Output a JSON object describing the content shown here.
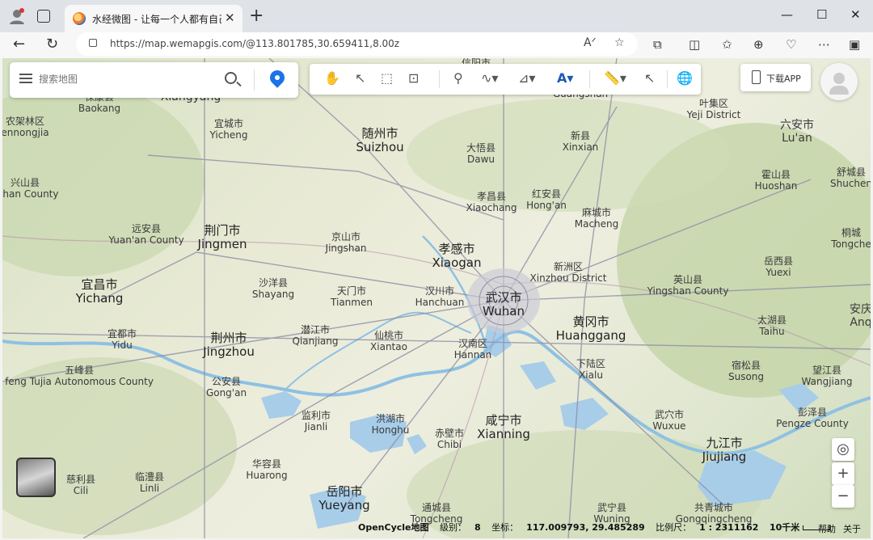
{
  "browser": {
    "tab_title": "水经微图 - 让每一个人都有自己的",
    "url": "https://map.wemapgis.com/@113.801785,30.659411,8.00z",
    "new_tab": "+",
    "close": "✕",
    "minimize": "—",
    "maximize": "☐",
    "window_close": "✕"
  },
  "search": {
    "placeholder": "搜索地图"
  },
  "toolbar_icons": [
    "hand-pan-icon",
    "select-arrow-icon",
    "box-select-icon",
    "zoom-box-icon",
    "marker-icon",
    "polyline-icon",
    "polygon-icon",
    "text-icon",
    "measure-icon",
    "pick-icon",
    "globe-icon"
  ],
  "download_app": "下载APP",
  "controls": {
    "locate": "◎",
    "zoom_in": "+",
    "zoom_out": "−"
  },
  "status": {
    "source": "OpenCycle地图",
    "level_label": "级别：",
    "level": "8",
    "coord_label": "坐标：",
    "coord": "117.009793, 29.485289",
    "scale_label": "比例尺：",
    "scale": "1 : 2311162",
    "scalebar": "10千米",
    "help": "帮助",
    "about": "关于"
  },
  "cities": [
    {
      "cn": "保康县",
      "en": "Baokang",
      "size": "small"
    },
    {
      "cn": "",
      "en": "Xiangyang",
      "size": "big"
    },
    {
      "cn": "宜城市",
      "en": "Yicheng",
      "size": "small"
    },
    {
      "cn": "随州市",
      "en": "Suizhou",
      "size": "major"
    },
    {
      "cn": "大悟县",
      "en": "Dawu",
      "size": "small"
    },
    {
      "cn": "",
      "en": "Guangshan",
      "size": "small"
    },
    {
      "cn": "新县",
      "en": "Xinxian",
      "size": "small"
    },
    {
      "cn": "叶集区",
      "en": "Yeji District",
      "size": "small"
    },
    {
      "cn": "六安市",
      "en": "Lu'an",
      "size": "big"
    },
    {
      "cn": "农架林区",
      "en": "ennongjia",
      "size": "small"
    },
    {
      "cn": "兴山县",
      "en": "gshan County",
      "size": "small"
    },
    {
      "cn": "孝昌县",
      "en": "Xiaochang",
      "size": "small"
    },
    {
      "cn": "红安县",
      "en": "Hong'an",
      "size": "small"
    },
    {
      "cn": "麻城市",
      "en": "Macheng",
      "size": "small"
    },
    {
      "cn": "霍山县",
      "en": "Huoshan",
      "size": "small"
    },
    {
      "cn": "舒城县",
      "en": "Shuchen",
      "size": "small"
    },
    {
      "cn": "远安县",
      "en": "Yuan'an County",
      "size": "small"
    },
    {
      "cn": "荆门市",
      "en": "Jingmen",
      "size": "major"
    },
    {
      "cn": "京山市",
      "en": "Jingshan",
      "size": "small"
    },
    {
      "cn": "孝感市",
      "en": "Xiaogan",
      "size": "major"
    },
    {
      "cn": "新洲区",
      "en": "Xinzhou District",
      "size": "small"
    },
    {
      "cn": "桐城",
      "en": "Tongche",
      "size": "small"
    },
    {
      "cn": "岳西县",
      "en": "Yuexi",
      "size": "small"
    },
    {
      "cn": "宜昌市",
      "en": "Yichang",
      "size": "major"
    },
    {
      "cn": "沙洋县",
      "en": "Shayang",
      "size": "small"
    },
    {
      "cn": "天门市",
      "en": "Tianmen",
      "size": "small"
    },
    {
      "cn": "汉川市",
      "en": "Hanchuan",
      "size": "small"
    },
    {
      "cn": "武汉市",
      "en": "Wuhan",
      "size": "major"
    },
    {
      "cn": "英山县",
      "en": "Yingshan County",
      "size": "small"
    },
    {
      "cn": "安庆",
      "en": "Anq",
      "size": "big"
    },
    {
      "cn": "宜都市",
      "en": "Yidu",
      "size": "small"
    },
    {
      "cn": "荆州市",
      "en": "Jingzhou",
      "size": "major"
    },
    {
      "cn": "潜江市",
      "en": "Qianjiang",
      "size": "small"
    },
    {
      "cn": "仙桃市",
      "en": "Xiantao",
      "size": "small"
    },
    {
      "cn": "汉南区",
      "en": "Hannan",
      "size": "small"
    },
    {
      "cn": "黄冈市",
      "en": "Huanggang",
      "size": "major"
    },
    {
      "cn": "太湖县",
      "en": "Taihu",
      "size": "small"
    },
    {
      "cn": "五峰县",
      "en": "feng Tujia Autonomous County",
      "size": "small"
    },
    {
      "cn": "公安县",
      "en": "Gong'an",
      "size": "small"
    },
    {
      "cn": "下陆区",
      "en": "Xialu",
      "size": "small"
    },
    {
      "cn": "宿松县",
      "en": "Susong",
      "size": "small"
    },
    {
      "cn": "望江县",
      "en": "Wangjiang",
      "size": "small"
    },
    {
      "cn": "监利市",
      "en": "Jianli",
      "size": "small"
    },
    {
      "cn": "洪湖市",
      "en": "Honghu",
      "size": "small"
    },
    {
      "cn": "赤壁市",
      "en": "Chibi",
      "size": "small"
    },
    {
      "cn": "咸宁市",
      "en": "Xianning",
      "size": "major"
    },
    {
      "cn": "武穴市",
      "en": "Wuxue",
      "size": "small"
    },
    {
      "cn": "彭泽县",
      "en": "Pengze County",
      "size": "small"
    },
    {
      "cn": "九江市",
      "en": "Jiujiang",
      "size": "major"
    },
    {
      "cn": "慈利县",
      "en": "Cili",
      "size": "small"
    },
    {
      "cn": "临澧县",
      "en": "Linli",
      "size": "small"
    },
    {
      "cn": "华容县",
      "en": "Huarong",
      "size": "small"
    },
    {
      "cn": "岳阳市",
      "en": "Yueyang",
      "size": "major"
    },
    {
      "cn": "通城县",
      "en": "Tongcheng",
      "size": "small"
    },
    {
      "cn": "武宁县",
      "en": "Wuning",
      "size": "small"
    },
    {
      "cn": "共青城市",
      "en": "Gongqingcheng",
      "size": "small"
    },
    {
      "cn": "信阳市",
      "en": "",
      "size": "small"
    }
  ]
}
